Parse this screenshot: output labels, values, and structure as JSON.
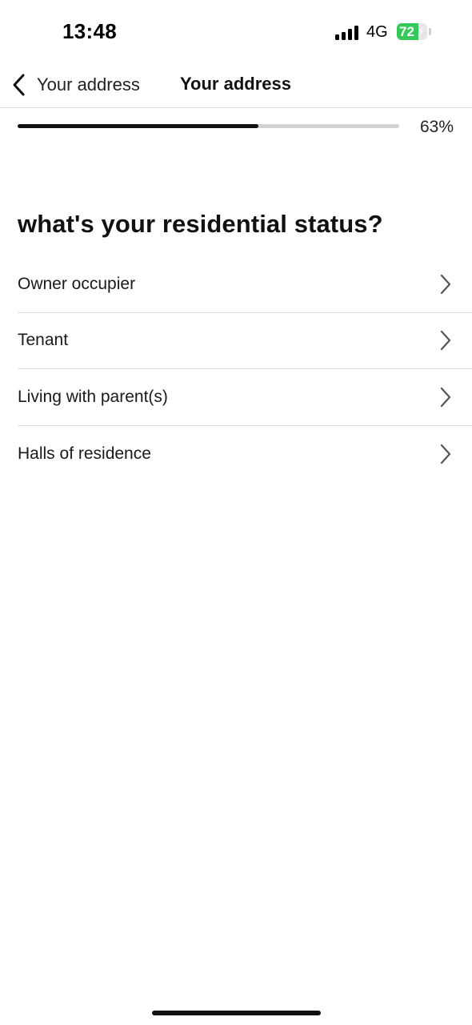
{
  "status_bar": {
    "time": "13:48",
    "network": "4G",
    "battery_level": "72",
    "battery_percent": 72,
    "battery_charging": true,
    "battery_color": "#34c759",
    "signal_icon": "cellular-signal-icon",
    "battery_icon": "battery-charging-icon"
  },
  "nav": {
    "back_label": "Your address",
    "back_icon": "chevron-left-icon",
    "title": "Your address"
  },
  "progress": {
    "value": 63,
    "label": "63%"
  },
  "question": "what's your residential status?",
  "options": [
    {
      "label": "Owner occupier",
      "icon": "chevron-right-icon"
    },
    {
      "label": "Tenant",
      "icon": "chevron-right-icon"
    },
    {
      "label": "Living with parent(s)",
      "icon": "chevron-right-icon"
    },
    {
      "label": "Halls of residence",
      "icon": "chevron-right-icon"
    }
  ]
}
